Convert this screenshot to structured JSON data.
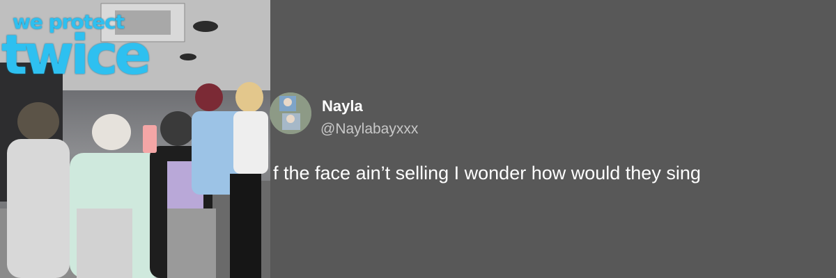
{
  "banner": {
    "logo_line1": "we protect",
    "logo_line2": "twice"
  },
  "tweet": {
    "name": "Nayla",
    "handle": "@Naylabayxxx",
    "text": "f the face ain’t selling I wonder how would they sing"
  },
  "colors": {
    "background": "#585858",
    "logo": "#2ec0f0",
    "name": "#ffffff",
    "handle": "#c8c8c8"
  }
}
